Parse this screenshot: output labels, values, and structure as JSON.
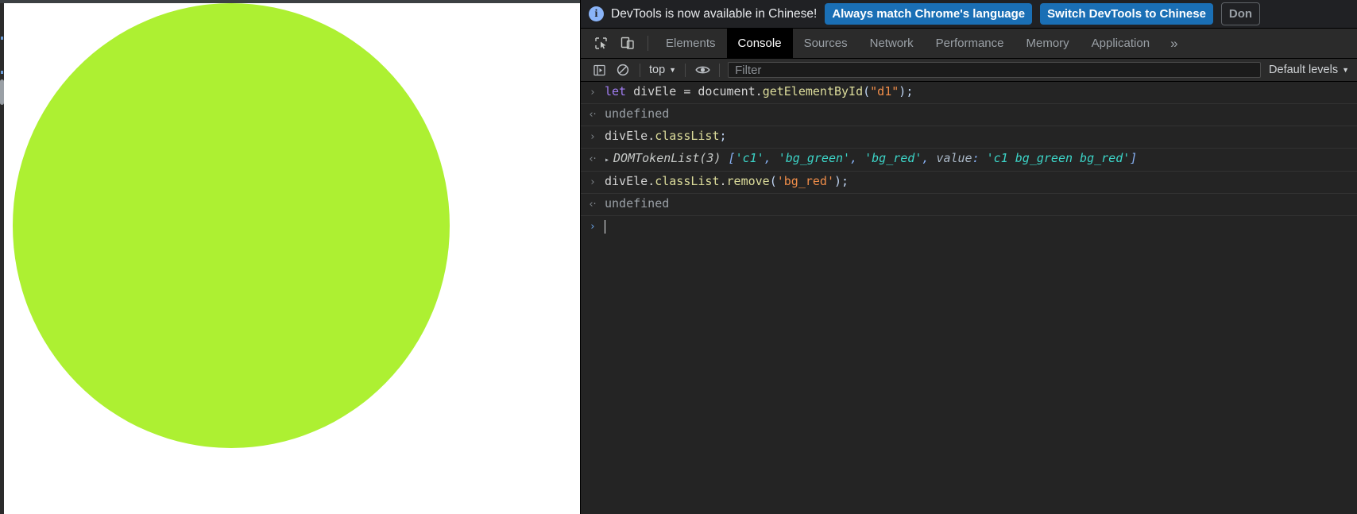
{
  "page": {
    "circle_color": "#adf032",
    "background": "#ffffff",
    "element_id": "d1"
  },
  "banner": {
    "info_icon": "info-icon",
    "text": "DevTools is now available in Chinese!",
    "buttons": [
      {
        "label": "Always match Chrome's language",
        "style": "primary"
      },
      {
        "label": "Switch DevTools to Chinese",
        "style": "primary"
      },
      {
        "label": "Don",
        "style": "secondary"
      }
    ]
  },
  "tabbar": {
    "icons": [
      {
        "name": "inspect-element-icon"
      },
      {
        "name": "device-toolbar-icon"
      }
    ],
    "tabs": [
      {
        "label": "Elements",
        "active": false
      },
      {
        "label": "Console",
        "active": true
      },
      {
        "label": "Sources",
        "active": false
      },
      {
        "label": "Network",
        "active": false
      },
      {
        "label": "Performance",
        "active": false
      },
      {
        "label": "Memory",
        "active": false
      },
      {
        "label": "Application",
        "active": false
      }
    ],
    "more_label": "»"
  },
  "filterbar": {
    "sidebar_toggle": "console-sidebar-icon",
    "clear_console": "clear-console-icon",
    "context": "top",
    "context_caret": "▼",
    "eye_icon": "live-expression-eye-icon",
    "filter_placeholder": "Filter",
    "filter_value": "",
    "levels_label": "Default levels",
    "levels_caret": "▼"
  },
  "console": {
    "input_marker": "›",
    "output_marker": "‹·",
    "expander": "▸",
    "messages": [
      {
        "kind": "input",
        "tokens": [
          {
            "text": "let ",
            "cls": "t-kw"
          },
          {
            "text": "divEle ",
            "cls": "t-plain"
          },
          {
            "text": "= ",
            "cls": "t-plain"
          },
          {
            "text": "document",
            "cls": "t-plain"
          },
          {
            "text": ".",
            "cls": "t-plain"
          },
          {
            "text": "getElementById",
            "cls": "t-prop"
          },
          {
            "text": "(",
            "cls": "t-punc"
          },
          {
            "text": "\"d1\"",
            "cls": "t-str"
          },
          {
            "text": ")",
            "cls": "t-punc"
          },
          {
            "text": ";",
            "cls": "t-punc"
          }
        ]
      },
      {
        "kind": "output",
        "tokens": [
          {
            "text": "undefined",
            "cls": "t-gray"
          }
        ]
      },
      {
        "kind": "input",
        "tokens": [
          {
            "text": "divEle",
            "cls": "t-plain"
          },
          {
            "text": ".",
            "cls": "t-plain"
          },
          {
            "text": "classList",
            "cls": "t-prop"
          },
          {
            "text": ";",
            "cls": "t-punc"
          }
        ]
      },
      {
        "kind": "output",
        "expandable": true,
        "tokens": [
          {
            "text": "DOMTokenList(3)",
            "cls": "t-objname"
          },
          {
            "text": " ",
            "cls": "t-plain"
          },
          {
            "text": "[",
            "cls": "t-arrpunc"
          },
          {
            "text": "'c1'",
            "cls": "t-arrstr"
          },
          {
            "text": ", ",
            "cls": "t-arrpunc"
          },
          {
            "text": "'bg_green'",
            "cls": "t-arrstr"
          },
          {
            "text": ", ",
            "cls": "t-arrpunc"
          },
          {
            "text": "'bg_red'",
            "cls": "t-arrstr"
          },
          {
            "text": ", ",
            "cls": "t-arrpunc"
          },
          {
            "text": "value",
            "cls": "t-key"
          },
          {
            "text": ": ",
            "cls": "t-arrpunc"
          },
          {
            "text": "'c1 bg_green bg_red'",
            "cls": "t-arrstr"
          },
          {
            "text": "]",
            "cls": "t-arrpunc"
          }
        ]
      },
      {
        "kind": "input",
        "tokens": [
          {
            "text": "divEle",
            "cls": "t-plain"
          },
          {
            "text": ".",
            "cls": "t-plain"
          },
          {
            "text": "classList",
            "cls": "t-prop"
          },
          {
            "text": ".",
            "cls": "t-plain"
          },
          {
            "text": "remove",
            "cls": "t-prop"
          },
          {
            "text": "(",
            "cls": "t-punc"
          },
          {
            "text": "'bg_red'",
            "cls": "t-str"
          },
          {
            "text": ")",
            "cls": "t-punc"
          },
          {
            "text": ";",
            "cls": "t-punc"
          }
        ]
      },
      {
        "kind": "output",
        "tokens": [
          {
            "text": "undefined",
            "cls": "t-gray"
          }
        ]
      }
    ]
  }
}
